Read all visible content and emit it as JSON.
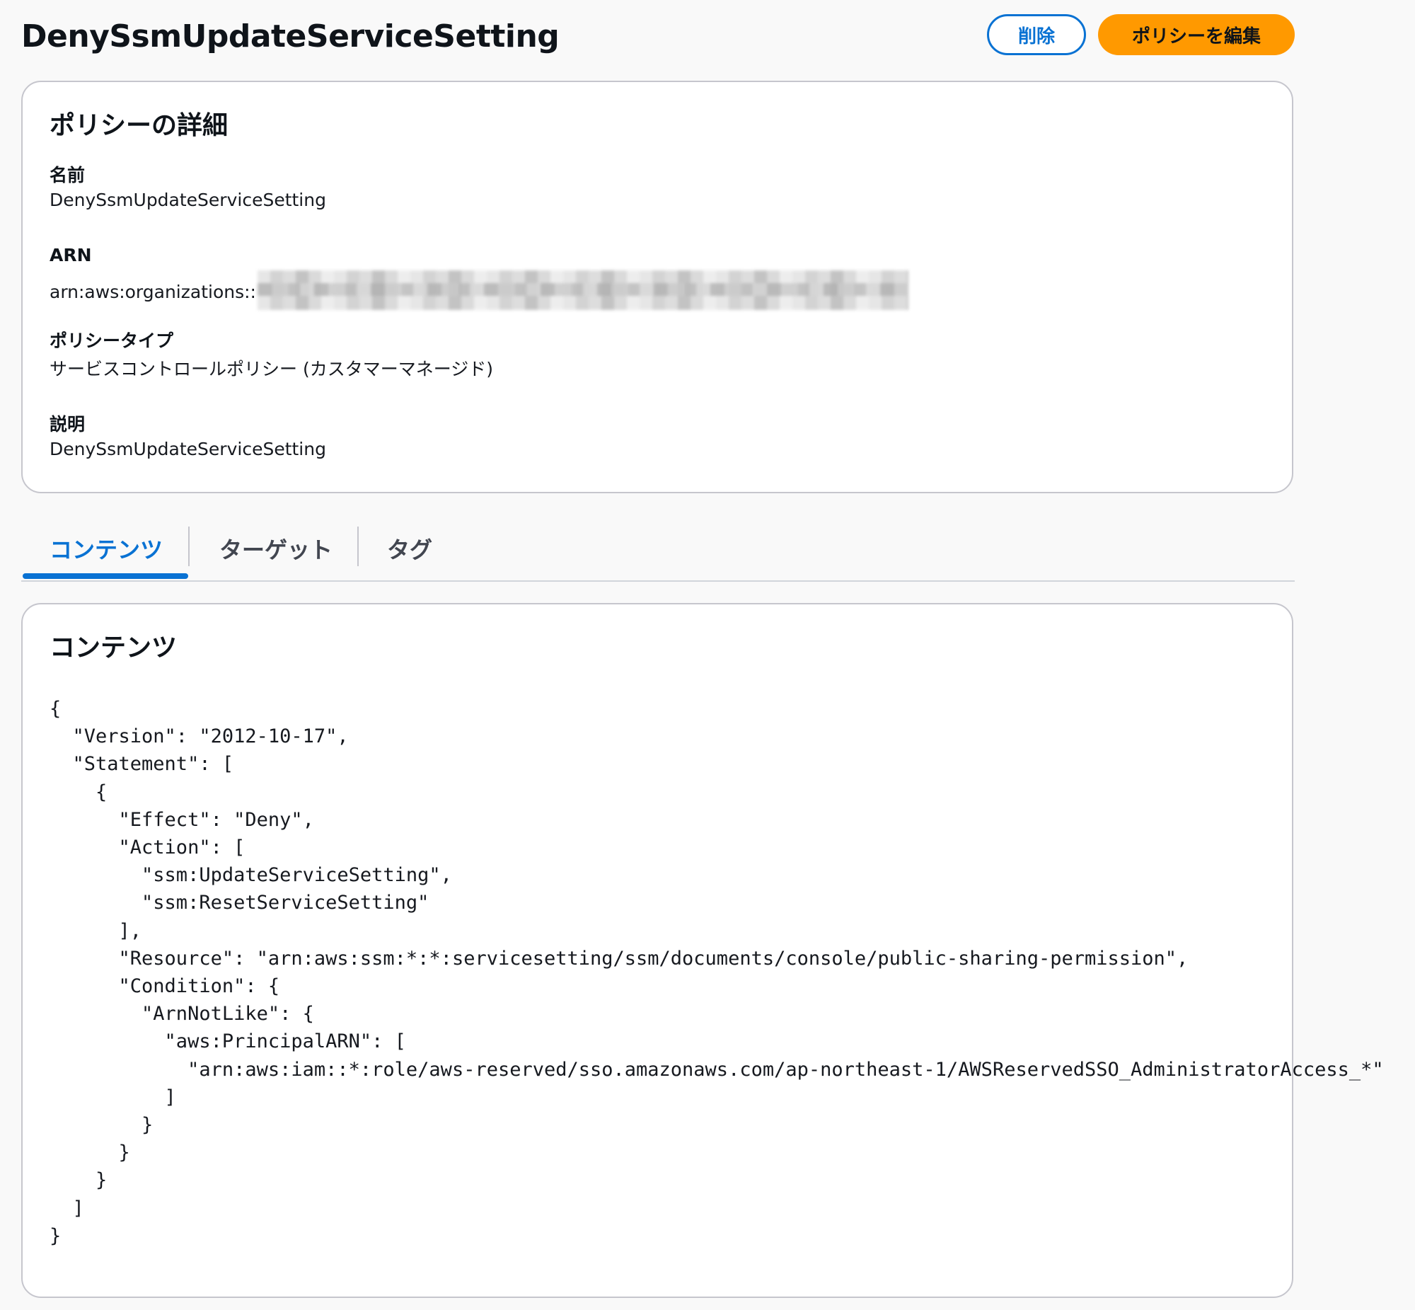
{
  "header": {
    "title": "DenySsmUpdateServiceSetting",
    "delete_label": "削除",
    "edit_label": "ポリシーを編集"
  },
  "details": {
    "title": "ポリシーの詳細",
    "name_label": "名前",
    "name_value": "DenySsmUpdateServiceSetting",
    "arn_label": "ARN",
    "arn_prefix": "arn:aws:organizations::",
    "type_label": "ポリシータイプ",
    "type_value": "サービスコントロールポリシー (カスタマーマネージド)",
    "description_label": "説明",
    "description_value": "DenySsmUpdateServiceSetting"
  },
  "tabs": [
    {
      "label": "コンテンツ",
      "active": true
    },
    {
      "label": "ターゲット",
      "active": false
    },
    {
      "label": "タグ",
      "active": false
    }
  ],
  "content": {
    "title": "コンテンツ",
    "policy_json": "{\n  \"Version\": \"2012-10-17\",\n  \"Statement\": [\n    {\n      \"Effect\": \"Deny\",\n      \"Action\": [\n        \"ssm:UpdateServiceSetting\",\n        \"ssm:ResetServiceSetting\"\n      ],\n      \"Resource\": \"arn:aws:ssm:*:*:servicesetting/ssm/documents/console/public-sharing-permission\",\n      \"Condition\": {\n        \"ArnNotLike\": {\n          \"aws:PrincipalARN\": [\n            \"arn:aws:iam::*:role/aws-reserved/sso.amazonaws.com/ap-northeast-1/AWSReservedSSO_AdministratorAccess_*\"\n          ]\n        }\n      }\n    }\n  ]\n}"
  },
  "colors": {
    "accent": "#0972d3",
    "primary_button": "#ff9900",
    "background": "#f9f9f9"
  }
}
